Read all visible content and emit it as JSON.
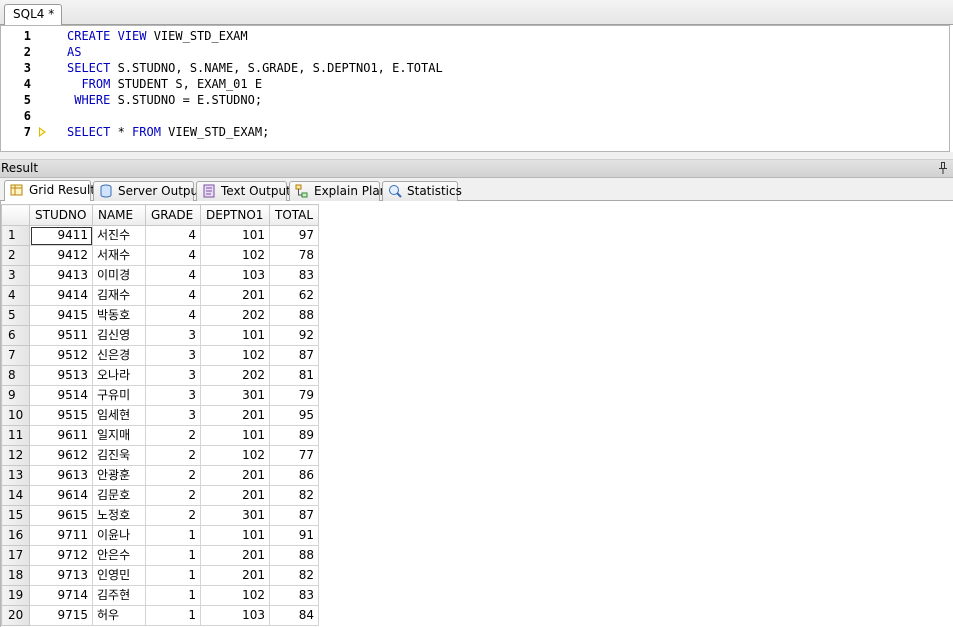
{
  "editor": {
    "tab_label": "SQL4 *",
    "lines": [
      {
        "n": "1",
        "parts": [
          {
            "t": "CREATE VIEW ",
            "kw": true
          },
          {
            "t": "VIEW_STD_EXAM",
            "kw": false
          }
        ]
      },
      {
        "n": "2",
        "parts": [
          {
            "t": "AS",
            "kw": true
          }
        ]
      },
      {
        "n": "3",
        "parts": [
          {
            "t": "SELECT ",
            "kw": true
          },
          {
            "t": "S.STUDNO, S.NAME, S.GRADE, S.DEPTNO1, E.TOTAL",
            "kw": false
          }
        ]
      },
      {
        "n": "4",
        "parts": [
          {
            "t": "  FROM ",
            "kw": true
          },
          {
            "t": "STUDENT S, EXAM_01 E",
            "kw": false
          }
        ]
      },
      {
        "n": "5",
        "parts": [
          {
            "t": " WHERE ",
            "kw": true
          },
          {
            "t": "S.STUDNO = E.STUDNO;",
            "kw": false
          }
        ]
      },
      {
        "n": "6",
        "parts": []
      },
      {
        "n": "7",
        "parts": [
          {
            "t": "SELECT ",
            "kw": true
          },
          {
            "t": "* ",
            "kw": false
          },
          {
            "t": "FROM ",
            "kw": true
          },
          {
            "t": "VIEW_STD_EXAM;",
            "kw": false
          }
        ],
        "current": true
      }
    ]
  },
  "result": {
    "title": "Result",
    "tabs": [
      {
        "label": "Grid Result",
        "icon": "grid-icon",
        "active": true
      },
      {
        "label": "Server Output",
        "icon": "server-icon",
        "active": false
      },
      {
        "label": "Text Output",
        "icon": "text-output-icon",
        "active": false
      },
      {
        "label": "Explain Plan",
        "icon": "explain-plan-icon",
        "active": false
      },
      {
        "label": "Statistics",
        "icon": "statistics-icon",
        "active": false
      }
    ],
    "columns": [
      "STUDNO",
      "NAME",
      "GRADE",
      "DEPTNO1",
      "TOTAL"
    ],
    "rows": [
      [
        "9411",
        "서진수",
        "4",
        "101",
        "97"
      ],
      [
        "9412",
        "서재수",
        "4",
        "102",
        "78"
      ],
      [
        "9413",
        "이미경",
        "4",
        "103",
        "83"
      ],
      [
        "9414",
        "김재수",
        "4",
        "201",
        "62"
      ],
      [
        "9415",
        "박동호",
        "4",
        "202",
        "88"
      ],
      [
        "9511",
        "김신영",
        "3",
        "101",
        "92"
      ],
      [
        "9512",
        "신은경",
        "3",
        "102",
        "87"
      ],
      [
        "9513",
        "오나라",
        "3",
        "202",
        "81"
      ],
      [
        "9514",
        "구유미",
        "3",
        "301",
        "79"
      ],
      [
        "9515",
        "임세현",
        "3",
        "201",
        "95"
      ],
      [
        "9611",
        "일지매",
        "2",
        "101",
        "89"
      ],
      [
        "9612",
        "김진욱",
        "2",
        "102",
        "77"
      ],
      [
        "9613",
        "안광훈",
        "2",
        "201",
        "86"
      ],
      [
        "9614",
        "김문호",
        "2",
        "201",
        "82"
      ],
      [
        "9615",
        "노정호",
        "2",
        "301",
        "87"
      ],
      [
        "9711",
        "이윤나",
        "1",
        "101",
        "91"
      ],
      [
        "9712",
        "안은수",
        "1",
        "201",
        "88"
      ],
      [
        "9713",
        "인영민",
        "1",
        "201",
        "82"
      ],
      [
        "9714",
        "김주현",
        "1",
        "102",
        "83"
      ],
      [
        "9715",
        "허우",
        "1",
        "103",
        "84"
      ]
    ]
  },
  "colors": {
    "keyword": "#0000c0",
    "arrow": "#e0b800"
  }
}
